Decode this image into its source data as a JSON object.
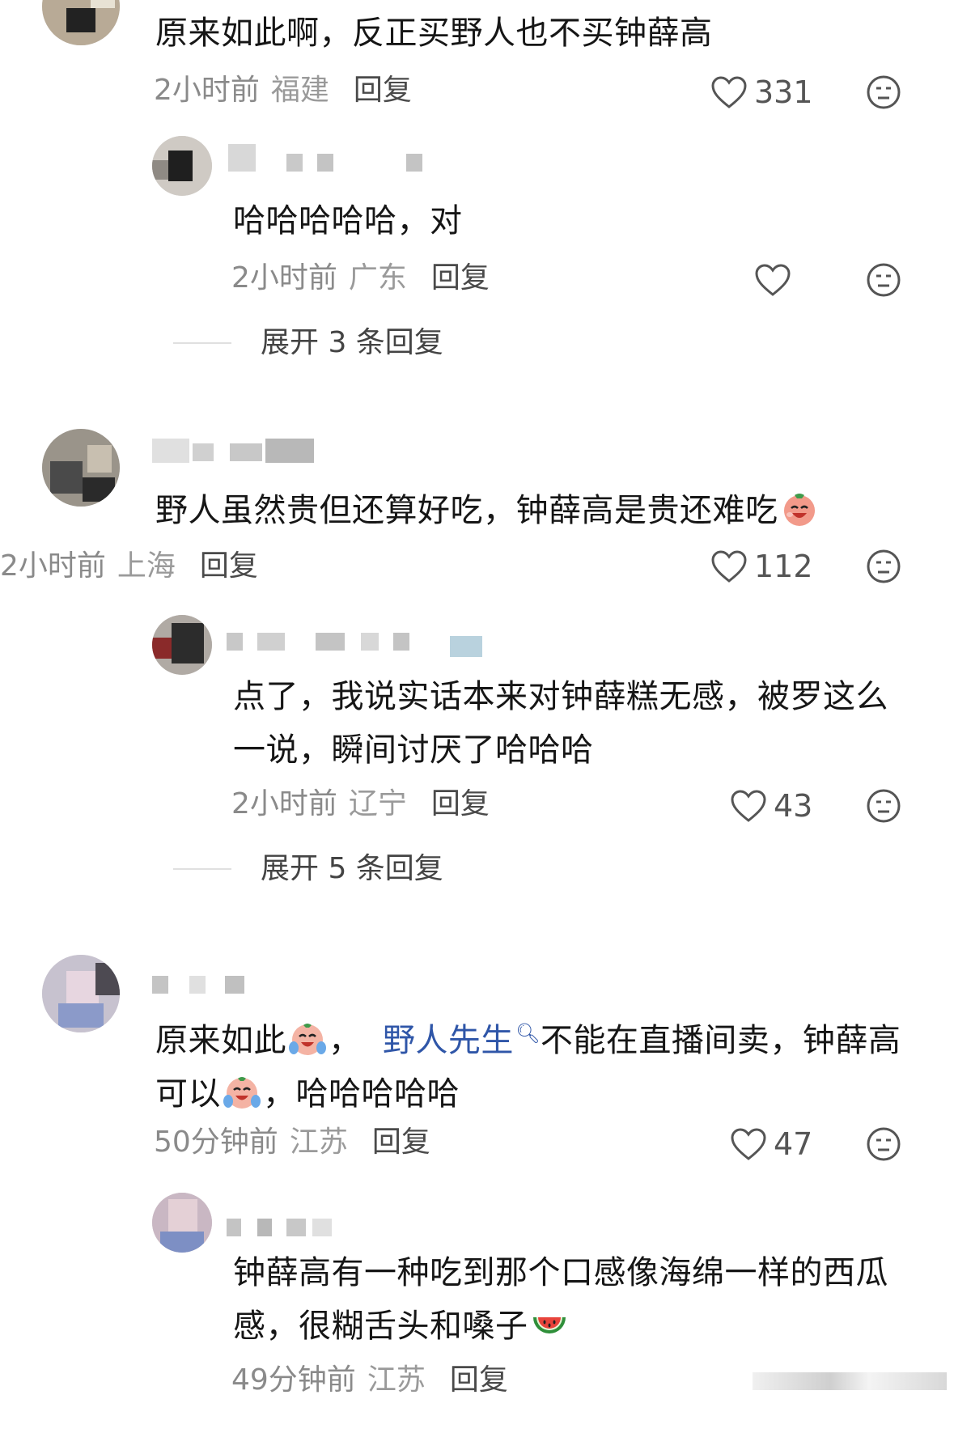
{
  "comments": [
    {
      "text": "原来如此啊，反正买野人也不买钟薛高",
      "time": "2小时前",
      "location": "福建",
      "reply_label": "回复",
      "likes": "331",
      "replies": [
        {
          "text": "哈哈哈哈哈，对",
          "time": "2小时前",
          "location": "广东",
          "reply_label": "回复",
          "likes": ""
        }
      ],
      "expand_label": "展开 3 条回复"
    },
    {
      "text": "野人虽然贵但还算好吃，钟薛高是贵还难吃",
      "emoji": "tomato-laugh-emoji",
      "time": "2小时前",
      "location": "上海",
      "reply_label": "回复",
      "likes": "112",
      "replies": [
        {
          "text_line1": "点了，我说实话本来对钟薛糕无感，被罗这么",
          "text_line2": "一说，瞬间讨厌了哈哈哈",
          "time": "2小时前",
          "location": "辽宁",
          "reply_label": "回复",
          "likes": "43"
        }
      ],
      "expand_label": "展开 5 条回复"
    },
    {
      "text_part1": "原来如此",
      "text_comma": "，",
      "mention": "野人先生",
      "text_part2": "不能在直播间卖，钟薛高",
      "text_part3": "可以",
      "text_part4": "，哈哈哈哈哈",
      "emoji": "crying-laugh-emoji",
      "time": "50分钟前",
      "location": "江苏",
      "reply_label": "回复",
      "likes": "47",
      "replies": [
        {
          "text_line1": "钟薛高有一种吃到那个口感像海绵一样的西瓜",
          "text_line2": "感，很糊舌头和嗓子",
          "emoji": "watermelon-emoji",
          "time": "49分钟前",
          "location": "江苏",
          "reply_label": "回复"
        }
      ]
    }
  ],
  "colors": {
    "meta": "#8a8a8a",
    "mention": "#2f56a8",
    "text": "#161616"
  }
}
